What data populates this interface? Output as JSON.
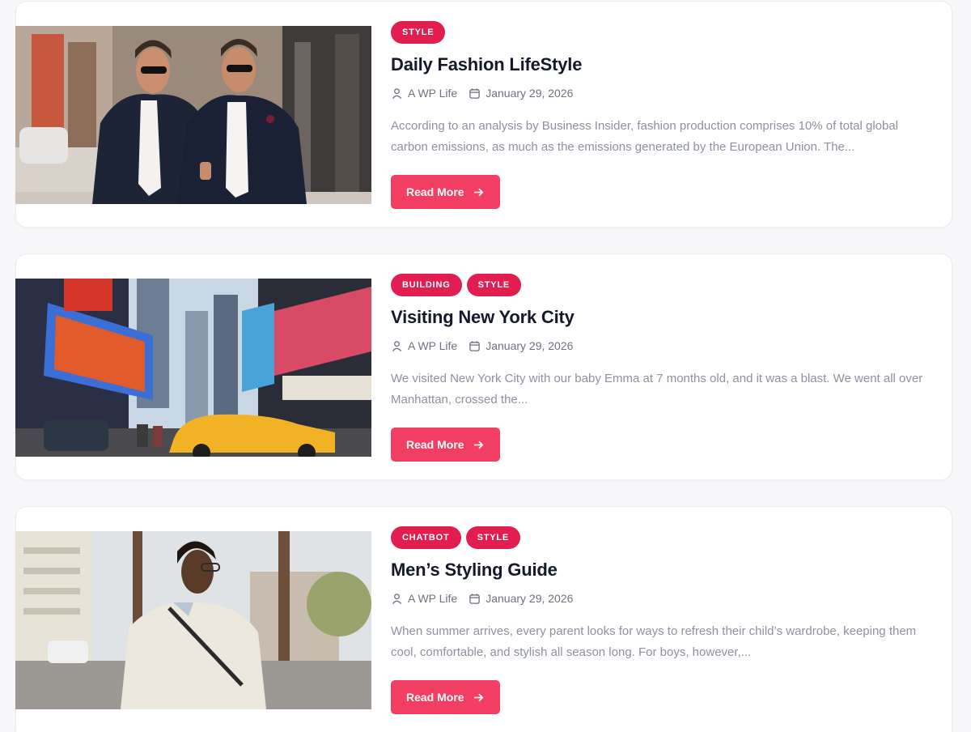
{
  "posts": [
    {
      "tags": [
        "STYLE"
      ],
      "title": "Daily Fashion LifeStyle",
      "author": "A WP Life",
      "date": "January 29, 2026",
      "excerpt": "According to an analysis by Business Insider, fashion production comprises 10% of total global carbon emissions, as much as the emissions generated by the European Union. The...",
      "button_label": "Read More"
    },
    {
      "tags": [
        "BUILDING",
        "STYLE"
      ],
      "title": "Visiting New York City",
      "author": "A WP Life",
      "date": "January 29, 2026",
      "excerpt": "We visited New York City with our baby Emma at 7 months old, and it was a blast. We went all over Manhattan, crossed the...",
      "button_label": "Read More"
    },
    {
      "tags": [
        "CHATBOT",
        "STYLE"
      ],
      "title": "Men’s Styling Guide",
      "author": "A WP Life",
      "date": "January 29, 2026",
      "excerpt": "When summer arrives, every parent looks for ways to refresh their child’s wardrobe, keeping them cool, comfortable, and stylish all season long. For boys, however,...",
      "button_label": "Read More"
    }
  ],
  "icons": {
    "author": "user-icon",
    "date": "calendar-icon",
    "button": "arrow-right-icon"
  },
  "colors": {
    "tag": "#e21d4f",
    "button": "#f23e62",
    "title": "#14192b",
    "meta": "#6c7280",
    "excerpt": "#8d92a0"
  }
}
